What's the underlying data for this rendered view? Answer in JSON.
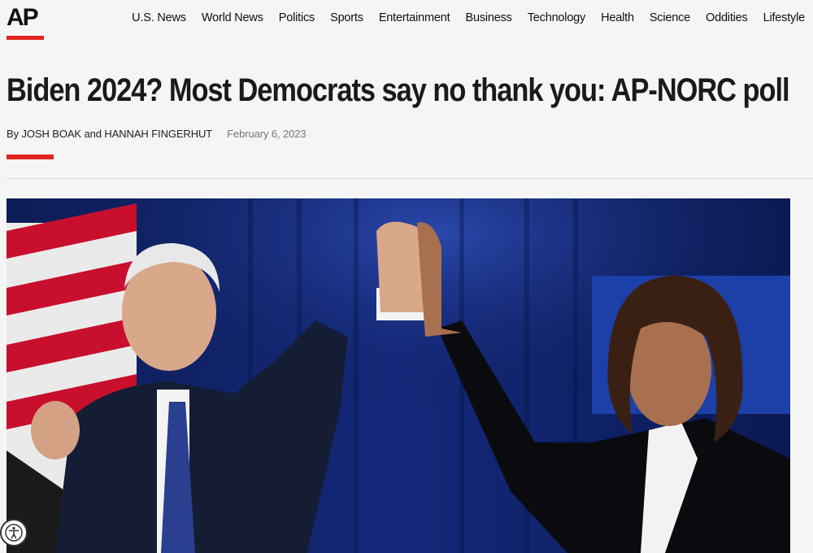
{
  "brand": {
    "logo_text": "AP"
  },
  "nav": {
    "items": [
      "U.S. News",
      "World News",
      "Politics",
      "Sports",
      "Entertainment",
      "Business",
      "Technology",
      "Health",
      "Science",
      "Oddities",
      "Lifestyle"
    ]
  },
  "article": {
    "headline": "Biden 2024? Most Democrats say no thank you: AP-NORC poll",
    "byline": "By JOSH BOAK and HANNAH FINGERHUT",
    "date": "February 6, 2023"
  },
  "colors": {
    "accent": "#e2261d"
  },
  "icons": {
    "accessibility": "accessibility-icon"
  }
}
